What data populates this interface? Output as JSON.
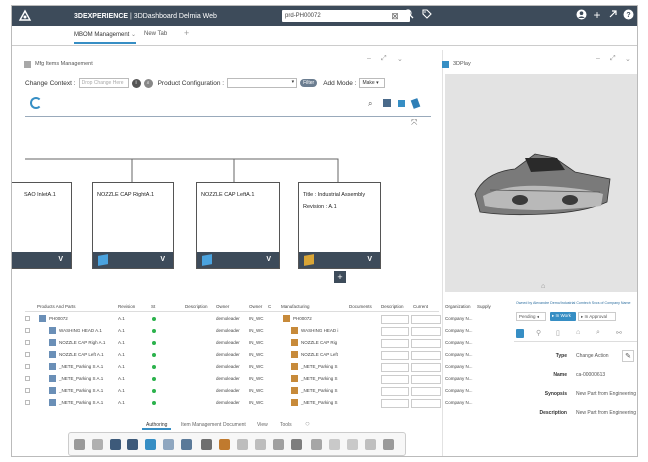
{
  "app": {
    "brand": "3DEXPERIENCE",
    "separator": " | ",
    "title": "3DDashboard Delmia Web",
    "search": "prd-PH00072"
  },
  "tabs": [
    {
      "label": "MBOM Management",
      "chev": "⌄"
    },
    {
      "label": "New Tab"
    }
  ],
  "left_panel": {
    "header": "Mfg Items Management",
    "context_label": "Change Context :",
    "drop_placeholder": "Drop Change Here",
    "product_config_label": "Product Configuration :",
    "filter_label": "Filter",
    "add_mode_label": "Add Mode :",
    "add_mode_value": "Make"
  },
  "right_panel": {
    "header": "3DPlay"
  },
  "cards": [
    {
      "title": "SAO InletA.1",
      "foot": "V"
    },
    {
      "title": "NOZZLE CAP RightA.1",
      "foot": "V"
    },
    {
      "title": "NOZZLE CAP LeftA.1",
      "foot": "V"
    },
    {
      "title": "Title : Industrial Assembly",
      "subtitle": "Revision : A.1",
      "foot": "V"
    }
  ],
  "add_button": "+",
  "table": {
    "headers": [
      "Products And Parts",
      "Revision",
      "St",
      "Description",
      "Owner",
      "Owner",
      "C",
      "Manufacturing",
      "Documents",
      "Description",
      "Current",
      "Organization",
      "Supply"
    ],
    "rows": [
      {
        "name": "PH00072",
        "rev": "A.1",
        "owner": "demoleader",
        "org": "IN_WC",
        "mfg": "PH00072",
        "company": "Company N..."
      },
      {
        "name": "WASHING HEAD A.1",
        "rev": "A.1",
        "owner": "demoleader",
        "org": "IN_WC",
        "mfg": "WASHING HEAD i",
        "company": "Company N..."
      },
      {
        "name": "NOZZLE CAP Righ A.1",
        "rev": "A.1",
        "owner": "demoleader",
        "org": "IN_WC",
        "mfg": "NOZZLE CAP Rig",
        "company": "Company N..."
      },
      {
        "name": "NOZZLE CAP Left A.1",
        "rev": "A.1",
        "owner": "demoleader",
        "org": "IN_WC",
        "mfg": "NOZZLE CAP Left",
        "company": "Company N..."
      },
      {
        "name": "_NETE_Parking S A.1",
        "rev": "A.1",
        "owner": "demoleader",
        "org": "IN_WC",
        "mfg": "_NETE_Parking S",
        "company": "Company N..."
      },
      {
        "name": "_NETE_Parking S A.1",
        "rev": "A.1",
        "owner": "demoleader",
        "org": "IN_WC",
        "mfg": "_NETE_Parking S",
        "company": "Company N..."
      },
      {
        "name": "_NETE_Parking S A.1",
        "rev": "A.1",
        "owner": "demoleader",
        "org": "IN_WC",
        "mfg": "_NETE_Parking S",
        "company": "Company N..."
      },
      {
        "name": "_NETE_Parking S A.1",
        "rev": "A.1",
        "owner": "demoleader",
        "org": "IN_WC",
        "mfg": "_NETE_Parking S",
        "company": "Company N..."
      }
    ]
  },
  "properties": {
    "owner_text": "Owned by Alexandre Demo/Industrial Comtech Svcs of Company Name",
    "actions": [
      "Pending",
      "In Work",
      "In Approval"
    ],
    "fields": [
      {
        "label": "Type",
        "value": "Change Action"
      },
      {
        "label": "Name",
        "value": "ca-00000613"
      },
      {
        "label": "Synopsis",
        "value": "New Part from Engineering"
      },
      {
        "label": "Description",
        "value": "New Part from Engineering"
      }
    ]
  },
  "bottom_tabs": [
    "Authoring",
    "Item Management",
    "Document",
    "View",
    "Tools"
  ],
  "colors": {
    "topbar": "#3d4b5a",
    "accent": "#368ec4",
    "status_green": "#2bb24c"
  }
}
